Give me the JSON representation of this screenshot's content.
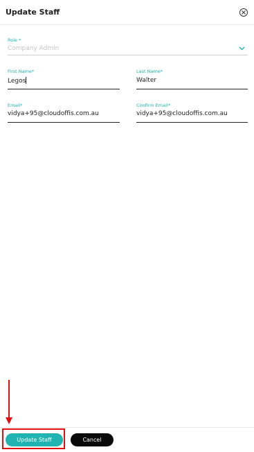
{
  "dialog": {
    "title": "Update Staff"
  },
  "form": {
    "role": {
      "label": "Role *",
      "value": "Company Admin"
    },
    "first_name": {
      "label": "First Name*",
      "value": "Legos"
    },
    "last_name": {
      "label": "Last Name*",
      "value": "Walter"
    },
    "email": {
      "label": "Email*",
      "value": "vidya+95@cloudoffis.com.au"
    },
    "confirm_email": {
      "label": "Confirm Email*",
      "value": "vidya+95@cloudoffis.com.au"
    }
  },
  "footer": {
    "update_label": "Update Staff",
    "cancel_label": "Cancel"
  },
  "colors": {
    "accent": "#1fb4b1",
    "highlight": "#e01010"
  }
}
